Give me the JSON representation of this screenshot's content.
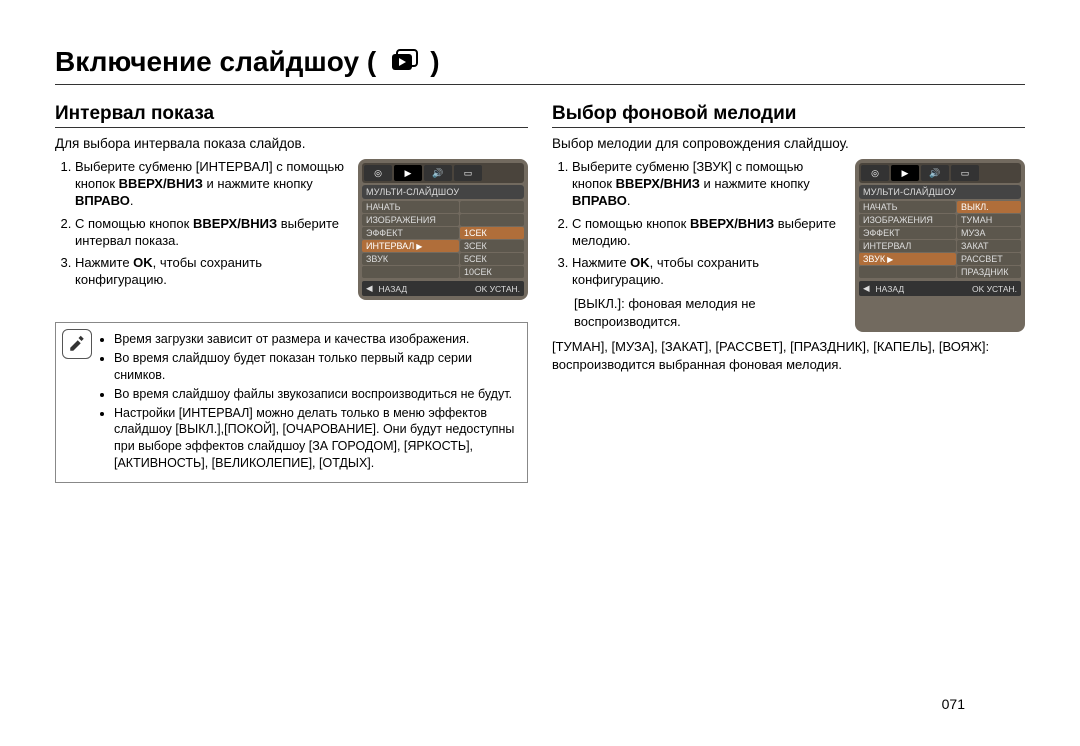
{
  "page": {
    "title": "Включение слайдшоу (",
    "title_close": ")",
    "number": "071"
  },
  "left": {
    "heading": "Интервал показа",
    "lead": "Для выбора интервала показа слайдов.",
    "steps": [
      {
        "num": "1.",
        "a": "Выберите субменю [ИНТЕРВАЛ] с помощью кнопок ",
        "b1": "ВВЕРХ/ВНИЗ",
        "mid": " и нажмите кнопку ",
        "b2": "ВПРАВО",
        "end": "."
      },
      {
        "num": "2.",
        "a": "С помощью кнопок ",
        "b1": "ВВЕРХ/ВНИЗ",
        "mid": " выберите интервал показа.",
        "b2": "",
        "end": ""
      },
      {
        "num": "3.",
        "a": "Нажмите ",
        "b1": "OK",
        "mid": ", чтобы сохранить конфигурацию.",
        "b2": "",
        "end": ""
      }
    ],
    "panel": {
      "header": "МУЛЬТИ-СЛАЙДШОУ",
      "rows_left": [
        "НАЧАТЬ",
        "ИЗОБРАЖЕНИЯ",
        "ЭФФЕКТ",
        "ИНТЕРВАЛ",
        "ЗВУК",
        ""
      ],
      "rows_right": [
        "",
        "",
        "1СЕК",
        "3СЕК",
        "5СЕК",
        "10СЕК"
      ],
      "selected_left_index": 3,
      "selected_right_index": 2,
      "footer_back": "НАЗАД",
      "footer_ok": "OK  УСТАН."
    },
    "notes": [
      "Время загрузки зависит от размера и качества изображения.",
      "Во время слайдшоу будет показан только первый кадр серии снимков.",
      "Во время слайдшоу файлы звукозаписи воспроизводиться не будут.",
      "Настройки [ИНТЕРВАЛ] можно делать только в меню эффектов слайдшоу [ВЫКЛ.],[ПОКОЙ], [ОЧАРОВАНИЕ]. Они будут недоступны при выборе эффектов слайдшоу [ЗА ГОРОДОМ], [ЯРКОСТЬ], [АКТИВНОСТЬ], [ВЕЛИКОЛЕПИЕ], [ОТДЫХ]."
    ]
  },
  "right": {
    "heading": "Выбор фоновой мелодии",
    "lead": "Выбор мелодии для сопровождения слайдшоу.",
    "steps": [
      {
        "num": "1.",
        "a": "Выберите субменю [ЗВУК] с помощью кнопок ",
        "b1": "ВВЕРХ/ВНИЗ",
        "mid": " и нажмите кнопку ",
        "b2": "ВПРАВО",
        "end": "."
      },
      {
        "num": "2.",
        "a": "С помощью кнопок ",
        "b1": "ВВЕРХ/ВНИЗ",
        "mid": " выберите мелодию.",
        "b2": "",
        "end": ""
      },
      {
        "num": "3.",
        "a": "Нажмите ",
        "b1": "OK",
        "mid": ", чтобы сохранить конфигурацию.",
        "b2": "",
        "end": ""
      }
    ],
    "panel": {
      "header": "МУЛЬТИ-СЛАЙДШОУ",
      "rows_left": [
        "НАЧАТЬ",
        "ИЗОБРАЖЕНИЯ",
        "ЭФФЕКТ",
        "ИНТЕРВАЛ",
        "ЗВУК",
        ""
      ],
      "rows_right": [
        "ВЫКЛ.",
        "ТУМАН",
        "МУЗА",
        "ЗАКАТ",
        "РАССВЕТ",
        "ПРАЗДНИК"
      ],
      "selected_left_index": 4,
      "selected_right_index": 0,
      "footer_back": "НАЗАД",
      "footer_ok": "OK  УСТАН."
    },
    "extra1_label": "[ВЫКЛ.]: ",
    "extra1_text": "фоновая мелодия не воспроизводится.",
    "extra2": "[ТУМАН], [МУЗА], [ЗАКАТ], [РАССВЕТ], [ПРАЗДНИК], [КАПЕЛЬ], [ВОЯЖ]: воспроизводится выбранная фоновая мелодия."
  }
}
